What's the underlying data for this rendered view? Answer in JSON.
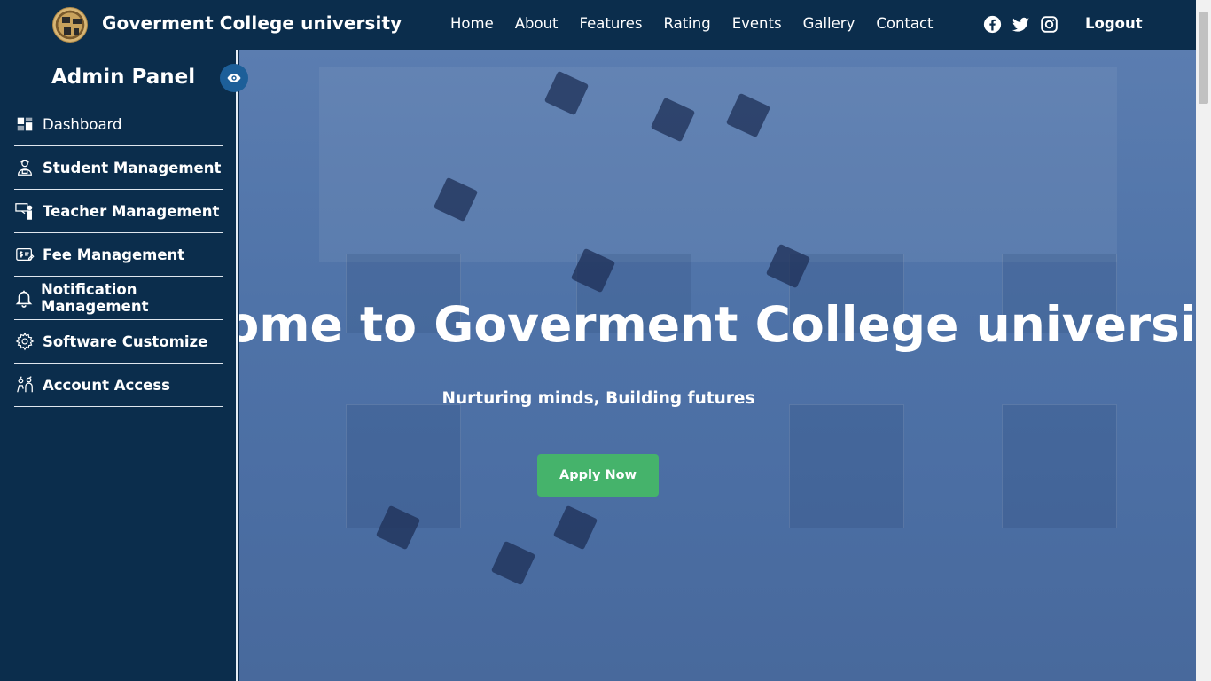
{
  "header": {
    "brand": "Goverment College university",
    "nav": [
      "Home",
      "About",
      "Features",
      "Rating",
      "Events",
      "Gallery",
      "Contact"
    ],
    "social": [
      "facebook-icon",
      "twitter-icon",
      "instagram-icon"
    ],
    "logout": "Logout"
  },
  "sidebar": {
    "title": "Admin Panel",
    "items": [
      {
        "label": "Dashboard",
        "icon": "dashboard-icon"
      },
      {
        "label": "Student Management",
        "icon": "student-icon"
      },
      {
        "label": "Teacher Management",
        "icon": "teacher-icon"
      },
      {
        "label": "Fee Management",
        "icon": "fee-icon"
      },
      {
        "label": "Notification Management",
        "icon": "bell-icon"
      },
      {
        "label": "Software Customize",
        "icon": "gear-icon"
      },
      {
        "label": "Account Access",
        "icon": "account-access-icon"
      }
    ]
  },
  "hero": {
    "title": "Welcome to Goverment College university",
    "subtitle": "Nurturing minds, Building futures",
    "cta": "Apply Now"
  },
  "colors": {
    "navbar": "#0b2d4c",
    "sidebar": "#0b2d4c",
    "cta": "#45b36b",
    "eye_button": "#1d5f99"
  }
}
